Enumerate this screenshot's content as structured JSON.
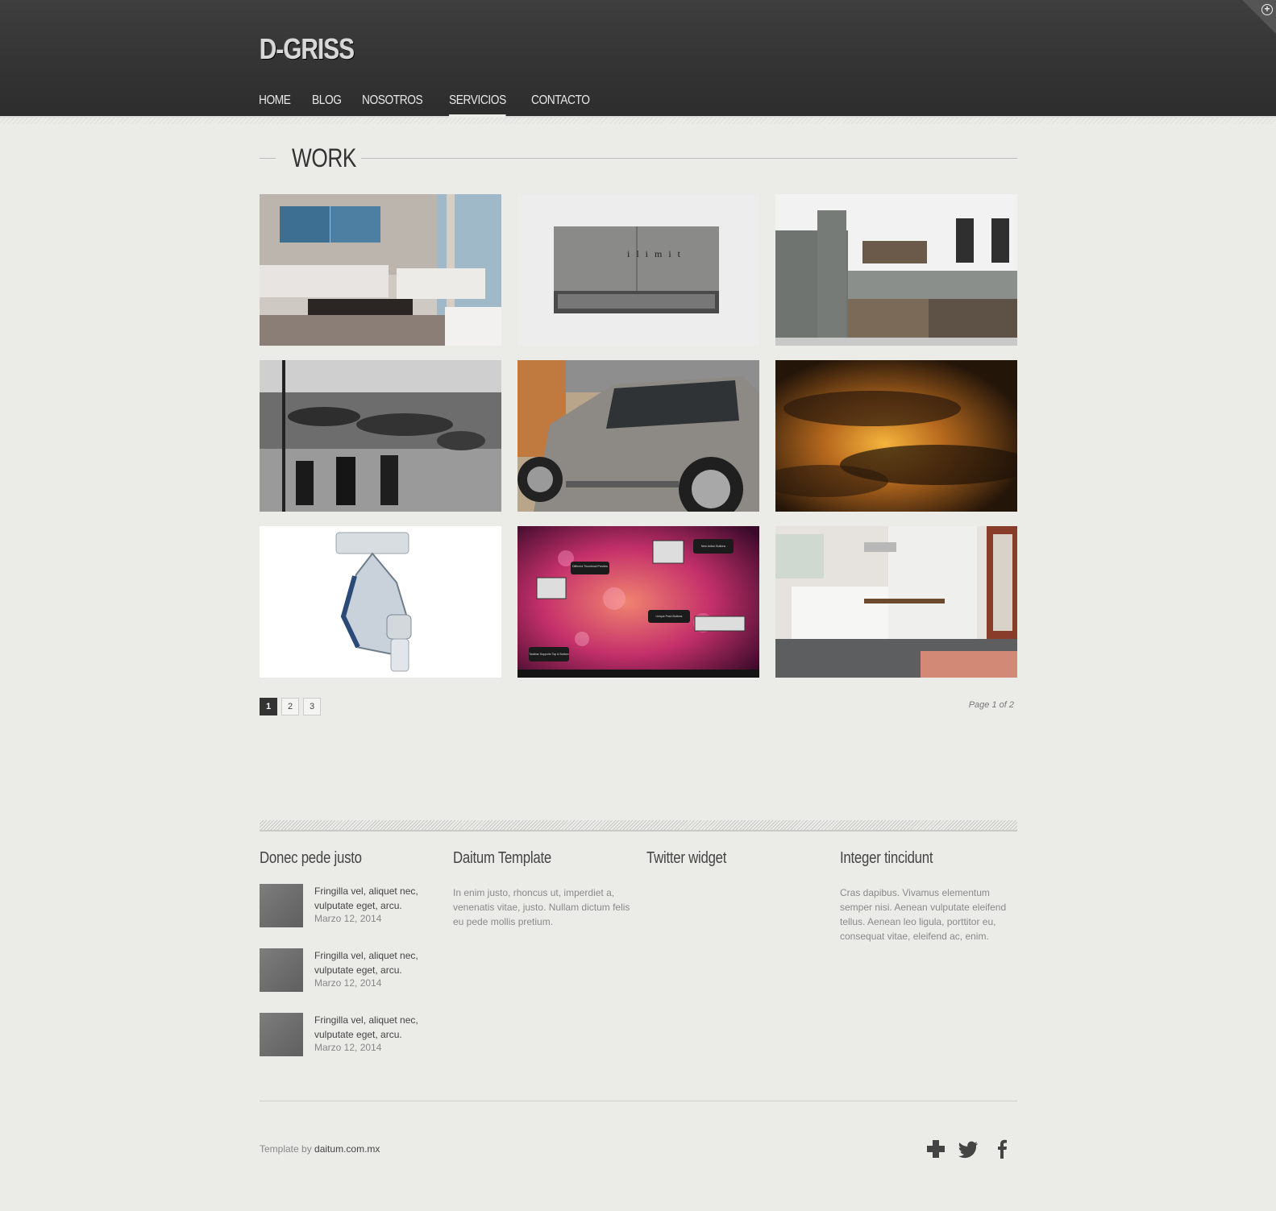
{
  "header": {
    "logo": "D-GRISS",
    "nav": [
      "HOME",
      "BLOG",
      "NOSOTROS",
      "SERVICIOS",
      "CONTACTO"
    ],
    "active_nav": "SERVICIOS",
    "corner_icon": "plus-circle-icon"
  },
  "work": {
    "title": "WORK",
    "items": [
      {
        "name": "living-room"
      },
      {
        "name": "ilimit-box",
        "caption": "ilimit"
      },
      {
        "name": "bathroom"
      },
      {
        "name": "vintage-beach"
      },
      {
        "name": "suv-car"
      },
      {
        "name": "sunset-clouds"
      },
      {
        "name": "medical-mask"
      },
      {
        "name": "desktop-screenshot",
        "labels": [
          "Different Thumbnail Preview",
          "New Action Buttons",
          "Unique Push Buttons",
          "Taskbar Supports Top & Bottom"
        ]
      },
      {
        "name": "kitchen"
      }
    ]
  },
  "pagination": {
    "pages": [
      "1",
      "2",
      "3"
    ],
    "current": "1",
    "info": "Page 1 of 2"
  },
  "widgets": {
    "posts": {
      "title": "Donec pede justo",
      "items": [
        {
          "title": "Fringilla vel, aliquet nec, vulputate eget, arcu.",
          "date": "Marzo 12, 2014"
        },
        {
          "title": "Fringilla vel, aliquet nec, vulputate eget, arcu.",
          "date": "Marzo 12, 2014"
        },
        {
          "title": "Fringilla vel, aliquet nec, vulputate eget, arcu.",
          "date": "Marzo 12, 2014"
        }
      ]
    },
    "template": {
      "title": "Daitum Template",
      "text": "In enim justo, rhoncus ut, imperdiet a, venenatis vitae, justo. Nullam dictum felis eu pede mollis pretium."
    },
    "twitter": {
      "title": "Twitter widget"
    },
    "integer": {
      "title": "Integer tincidunt",
      "text": "Cras dapibus. Vivamus elementum semper nisi. Aenean vulputate eleifend tellus. Aenean leo ligula, porttitor eu, consequat vitae, eleifend ac, enim."
    }
  },
  "footer": {
    "credit_prefix": "Template by",
    "credit_link": "daitum.com.mx",
    "social": [
      "plus-icon",
      "twitter-icon",
      "facebook-icon"
    ]
  }
}
